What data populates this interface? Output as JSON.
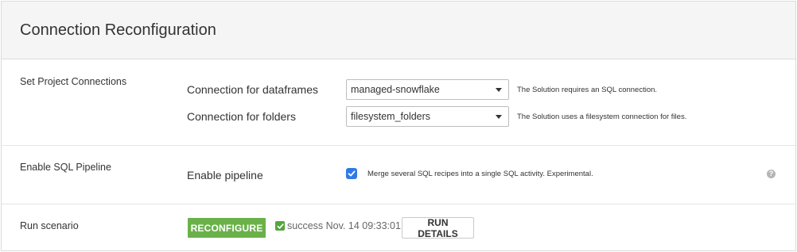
{
  "header": {
    "title": "Connection Reconfiguration"
  },
  "sections": {
    "connections": {
      "title": "Set Project Connections",
      "rows": [
        {
          "label": "Connection for dataframes",
          "value": "managed-snowflake",
          "hint": "The Solution requires an SQL connection."
        },
        {
          "label": "Connection for folders",
          "value": "filesystem_folders",
          "hint": "The Solution uses a filesystem connection for files."
        }
      ]
    },
    "pipeline": {
      "title": "Enable SQL Pipeline",
      "label": "Enable pipeline",
      "checked": true,
      "description": "Merge several SQL recipes into a single SQL activity. Experimental.",
      "help_icon": "question-circle-icon",
      "help_glyph": "?"
    },
    "scenario": {
      "title": "Run scenario",
      "reconfigure_label": "RECONFIGURE",
      "status_icon": "check-square-icon",
      "status_text": "success Nov. 14 09:33:01",
      "run_details_label": "RUN DETAILS"
    }
  },
  "colors": {
    "primary_green": "#6ab14a",
    "checkbox_blue": "#2f7ae5",
    "success_green": "#55a53f",
    "header_bg": "#f5f5f5"
  }
}
